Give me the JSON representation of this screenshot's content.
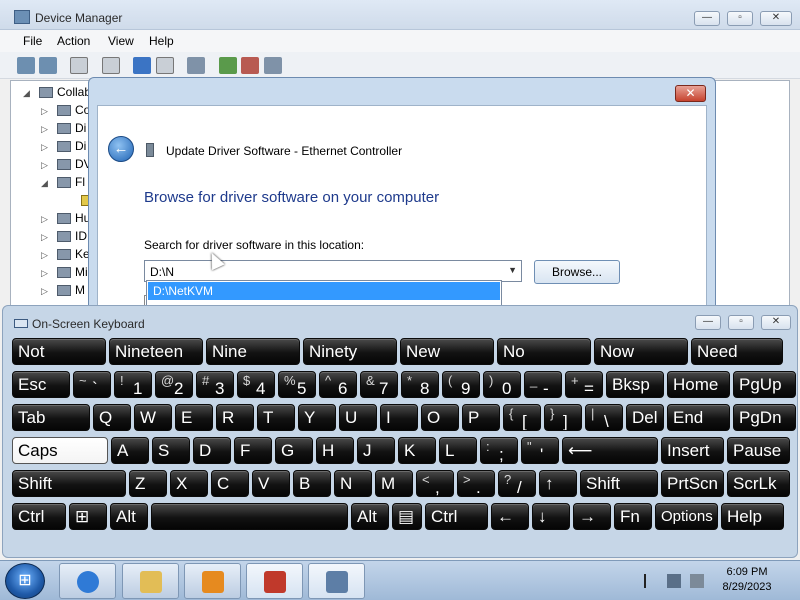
{
  "device_manager": {
    "title": "Device Manager",
    "menu": [
      "File",
      "Action",
      "View",
      "Help"
    ],
    "tree": {
      "root": "Collab",
      "items": [
        "Co",
        "Di",
        "Di",
        "DV",
        "Fl",
        "",
        "Hu",
        "ID",
        "Ke",
        "Mi",
        "M"
      ]
    }
  },
  "dialog": {
    "header_title": "Update Driver Software - Ethernet Controller",
    "heading": "Browse for driver software on your computer",
    "search_label": "Search for driver software in this location:",
    "path_value": "D:\\N",
    "suggestion": "D:\\NetKVM",
    "browse_label": "Browse...",
    "close_glyph": "✕"
  },
  "osk": {
    "title": "On-Screen Keyboard",
    "predictions": [
      "Not",
      "Nineteen",
      "Nine",
      "Ninety",
      "New",
      "No",
      "Now",
      "Need"
    ],
    "row1": [
      {
        "main": "Esc"
      },
      {
        "shift": "~",
        "main": "`"
      },
      {
        "shift": "!",
        "main": "1"
      },
      {
        "shift": "@",
        "main": "2"
      },
      {
        "shift": "#",
        "main": "3"
      },
      {
        "shift": "$",
        "main": "4"
      },
      {
        "shift": "%",
        "main": "5"
      },
      {
        "shift": "^",
        "main": "6"
      },
      {
        "shift": "&",
        "main": "7"
      },
      {
        "shift": "*",
        "main": "8"
      },
      {
        "shift": "(",
        "main": "9"
      },
      {
        "shift": ")",
        "main": "0"
      },
      {
        "shift": "_",
        "main": "-"
      },
      {
        "shift": "+",
        "main": "="
      },
      {
        "main": "Bksp"
      },
      {
        "main": "Home"
      },
      {
        "main": "PgUp"
      }
    ],
    "row2": [
      {
        "main": "Tab"
      },
      {
        "main": "Q"
      },
      {
        "main": "W"
      },
      {
        "main": "E"
      },
      {
        "main": "R"
      },
      {
        "main": "T"
      },
      {
        "main": "Y"
      },
      {
        "main": "U"
      },
      {
        "main": "I"
      },
      {
        "main": "O"
      },
      {
        "main": "P"
      },
      {
        "shift": "{",
        "main": "["
      },
      {
        "shift": "}",
        "main": "]"
      },
      {
        "shift": "|",
        "main": "\\"
      },
      {
        "main": "Del"
      },
      {
        "main": "End"
      },
      {
        "main": "PgDn"
      }
    ],
    "row3": [
      {
        "main": "Caps"
      },
      {
        "main": "A"
      },
      {
        "main": "S"
      },
      {
        "main": "D"
      },
      {
        "main": "F"
      },
      {
        "main": "G"
      },
      {
        "main": "H"
      },
      {
        "main": "J"
      },
      {
        "main": "K"
      },
      {
        "main": "L"
      },
      {
        "shift": ":",
        "main": ";"
      },
      {
        "shift": "\"",
        "main": "'"
      },
      {
        "main": "⟵"
      },
      {
        "main": "Insert"
      },
      {
        "main": "Pause"
      }
    ],
    "row4": [
      {
        "main": "Shift"
      },
      {
        "main": "Z"
      },
      {
        "main": "X"
      },
      {
        "main": "C"
      },
      {
        "main": "V"
      },
      {
        "main": "B"
      },
      {
        "main": "N"
      },
      {
        "main": "M"
      },
      {
        "shift": "<",
        "main": ","
      },
      {
        "shift": ">",
        "main": "."
      },
      {
        "shift": "?",
        "main": "/"
      },
      {
        "main": "↑"
      },
      {
        "main": "Shift"
      },
      {
        "main": "PrtScn"
      },
      {
        "main": "ScrLk"
      }
    ],
    "row5": [
      {
        "main": "Ctrl"
      },
      {
        "main": "⊞"
      },
      {
        "main": "Alt"
      },
      {
        "main": ""
      },
      {
        "main": "Alt"
      },
      {
        "main": "▤"
      },
      {
        "main": "Ctrl"
      },
      {
        "main": "←"
      },
      {
        "main": "↓"
      },
      {
        "main": "→"
      },
      {
        "main": "Fn"
      },
      {
        "main": "Options"
      },
      {
        "main": "Help"
      }
    ]
  },
  "taskbar": {
    "time": "6:09 PM",
    "date": "8/29/2023"
  },
  "colors": {
    "accent": "#3399ff",
    "heading": "#1e3a8c",
    "key": "#1a1a1a"
  }
}
